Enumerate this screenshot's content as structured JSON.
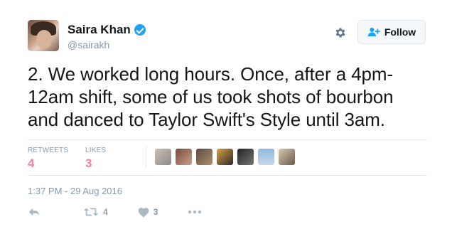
{
  "user": {
    "name": "Saira Khan",
    "handle": "@sairakh"
  },
  "buttons": {
    "follow_label": "Follow"
  },
  "tweet": {
    "text_line1": "2. We worked long hours. Once, after a 4pm-",
    "text_line2": "12am shift, some of us took shots of bourbon",
    "text_line3": "and danced to Taylor Swift's Style until 3am.",
    "timestamp": "1:37 PM - 29 Aug 2016"
  },
  "stats": {
    "retweets_label": "RETWEETS",
    "retweets_count": "4",
    "likes_label": "LIKES",
    "likes_count": "3"
  },
  "actions": {
    "retweet_count": "4",
    "like_count": "3"
  },
  "colors": {
    "verified": "#1da1f2",
    "stat_number": "#e81c4f",
    "muted": "#8899a6",
    "follow_icon": "#1da1f2"
  },
  "icons": [
    "verified-badge-icon",
    "gear-icon",
    "follow-person-plus-icon",
    "reply-icon",
    "retweet-icon",
    "heart-icon",
    "more-dots-icon"
  ]
}
